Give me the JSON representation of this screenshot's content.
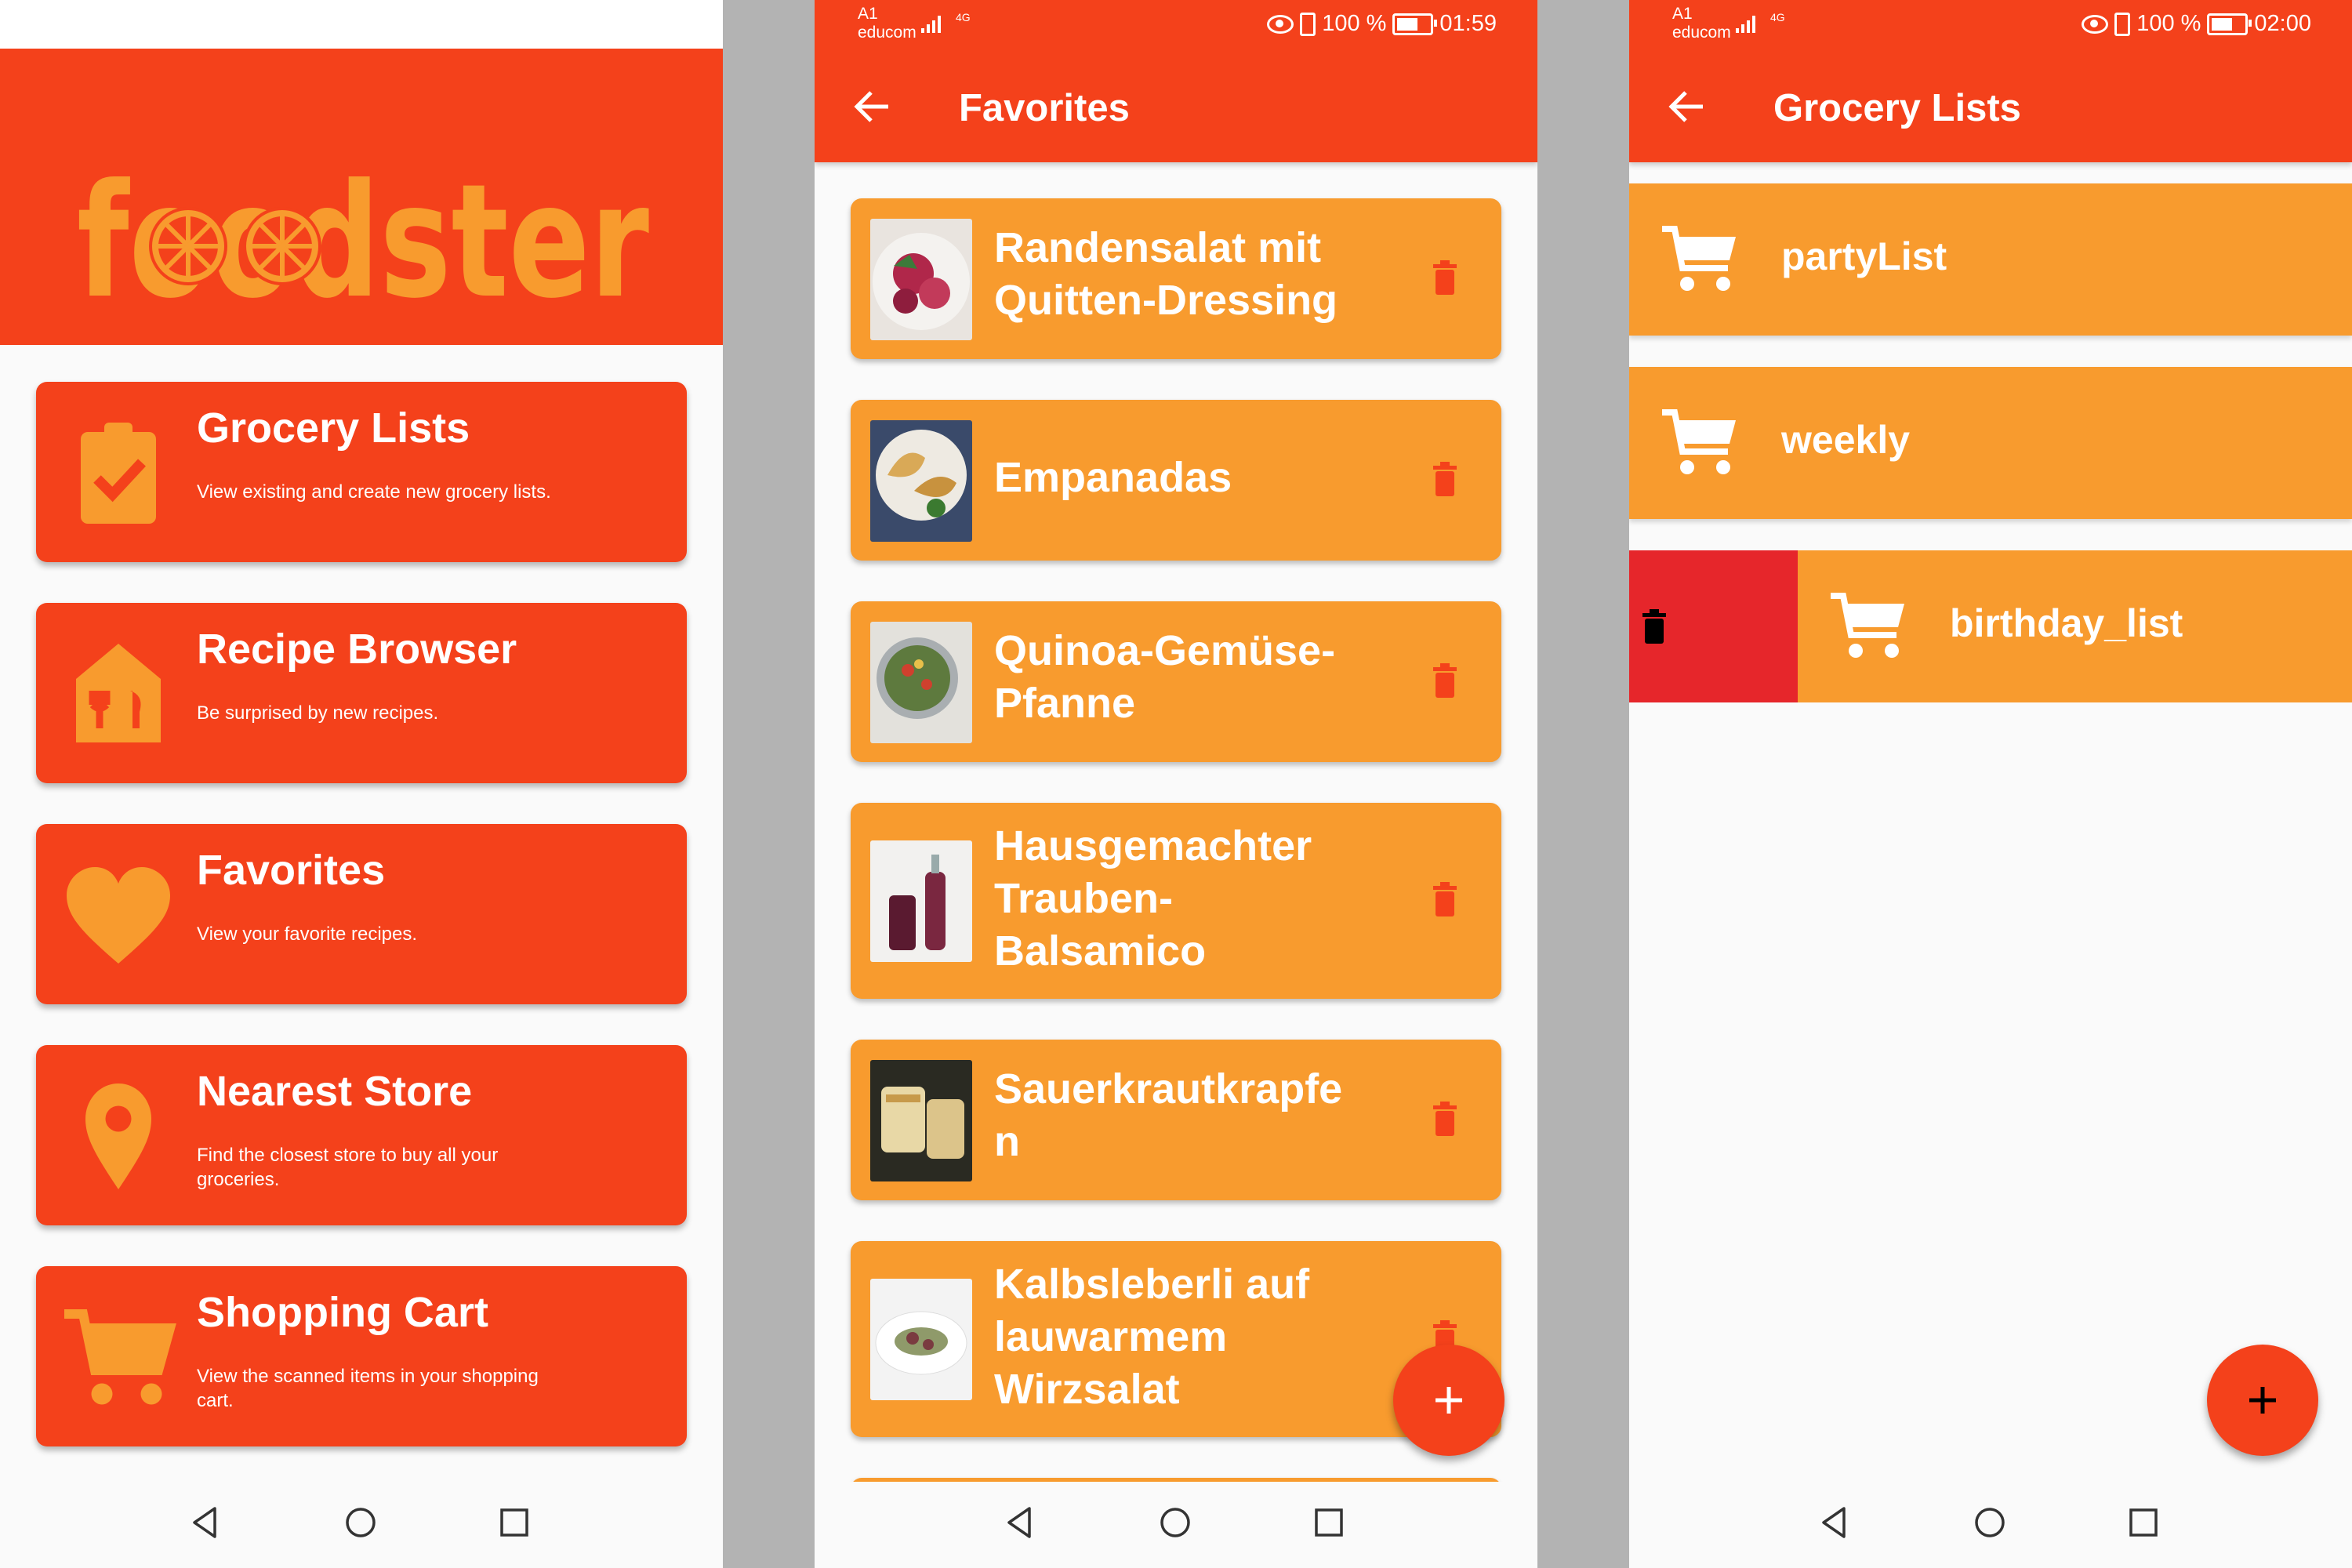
{
  "status": {
    "carrier_line1": "A1",
    "carrier_line2": "educom",
    "network_label": "4G",
    "battery": "100 %",
    "time_p2": "01:59",
    "time_p3": "02:00"
  },
  "home": {
    "logo_text": "foodster",
    "menu": [
      {
        "title": "Grocery Lists",
        "desc": "View existing and create new grocery lists.",
        "icon": "clipboard-check-icon"
      },
      {
        "title": "Recipe Browser",
        "desc": "Be surprised by new recipes.",
        "icon": "restaurant-icon"
      },
      {
        "title": "Favorites",
        "desc": "View your favorite recipes.",
        "icon": "heart-icon"
      },
      {
        "title": "Nearest Store",
        "desc": "Find the closest store to buy all your groceries.",
        "icon": "map-pin-icon"
      },
      {
        "title": "Shopping Cart",
        "desc": "View the scanned items in your shopping cart.",
        "icon": "shopping-cart-icon"
      }
    ]
  },
  "favorites": {
    "title": "Favorites",
    "items": [
      {
        "name": "Randensalat mit Quitten-Dressing"
      },
      {
        "name": "Empanadas"
      },
      {
        "name": "Quinoa-Gemüse-Pfanne"
      },
      {
        "name": "Hausgemachter Trauben-Balsamico"
      },
      {
        "name": "Sauerkrautkrapfe n"
      },
      {
        "name": "Kalbsleberli auf lauwarmem Wirzsalat"
      }
    ]
  },
  "grocery_lists": {
    "title": "Grocery Lists",
    "lists": [
      {
        "name": "partyList"
      },
      {
        "name": "weekly"
      },
      {
        "name": "birthday_list"
      }
    ]
  },
  "colors": {
    "primary": "#f4411b",
    "accent": "#f89b2e",
    "delete": "#e6262b",
    "logo": "#f89b2e"
  }
}
